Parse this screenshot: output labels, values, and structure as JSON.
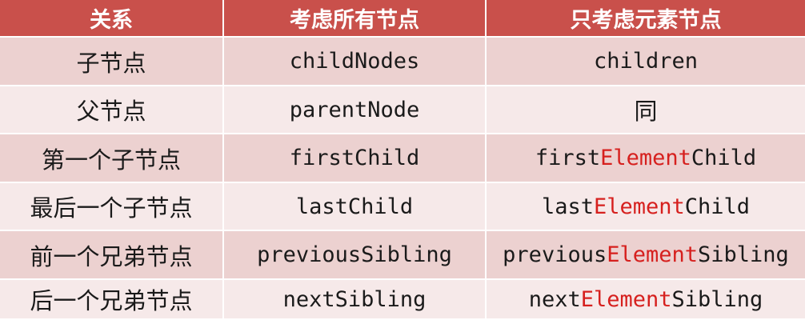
{
  "header": {
    "col1": "关系",
    "col2": "考虑所有节点",
    "col3": "只考虑元素节点"
  },
  "rows": [
    {
      "relation": "子节点",
      "all_nodes": "childNodes",
      "element_only": {
        "pre": "children",
        "hl": "",
        "post": ""
      }
    },
    {
      "relation": "父节点",
      "all_nodes": "parentNode",
      "element_only": {
        "pre": "同",
        "hl": "",
        "post": ""
      }
    },
    {
      "relation": "第一个子节点",
      "all_nodes": "firstChild",
      "element_only": {
        "pre": "first",
        "hl": "Element",
        "post": "Child"
      }
    },
    {
      "relation": "最后一个子节点",
      "all_nodes": "lastChild",
      "element_only": {
        "pre": "last",
        "hl": "Element",
        "post": "Child"
      }
    },
    {
      "relation": "前一个兄弟节点",
      "all_nodes": "previousSibling",
      "element_only": {
        "pre": "previous",
        "hl": "Element",
        "post": "Sibling"
      }
    },
    {
      "relation": "后一个兄弟节点",
      "all_nodes": "nextSibling",
      "element_only": {
        "pre": "next",
        "hl": "Element",
        "post": "Sibling"
      }
    }
  ],
  "colors": {
    "header_bg": "#c9504b",
    "row_odd_bg": "#ecd1d0",
    "row_even_bg": "#f6e9e9",
    "highlight": "#d6201e"
  }
}
